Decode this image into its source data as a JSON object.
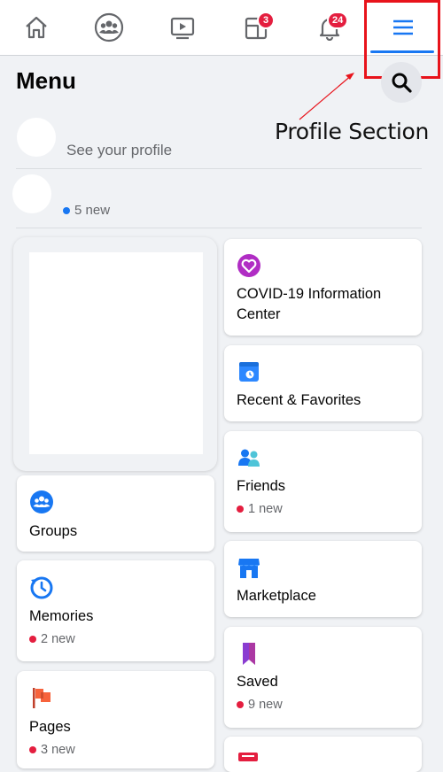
{
  "nav": {
    "groups_badge": "",
    "pages_badge": "3",
    "notifications_badge": "24"
  },
  "menu": {
    "title": "Menu"
  },
  "annotation": {
    "label": "Profile Section"
  },
  "profile": {
    "subtitle": "See your profile",
    "second_new": "5 new"
  },
  "colors": {
    "accent": "#1877f2",
    "badge": "#e41e3f",
    "highlight_box": "#e8131b"
  },
  "shortcuts_left": [
    {
      "label": "Groups",
      "sub": "",
      "icon": "groups-icon"
    },
    {
      "label": "Memories",
      "sub": "2 new",
      "icon": "memories-icon"
    },
    {
      "label": "Pages",
      "sub": "3 new",
      "icon": "pages-flag-icon"
    }
  ],
  "shortcuts_right": [
    {
      "label": "COVID-19 Information Center",
      "sub": "",
      "icon": "covid-heart-icon"
    },
    {
      "label": "Recent & Favorites",
      "sub": "",
      "icon": "recent-favorites-icon"
    },
    {
      "label": "Friends",
      "sub": "1 new",
      "icon": "friends-icon"
    },
    {
      "label": "Marketplace",
      "sub": "",
      "icon": "marketplace-icon"
    },
    {
      "label": "Saved",
      "sub": "9 new",
      "icon": "saved-bookmark-icon"
    }
  ]
}
